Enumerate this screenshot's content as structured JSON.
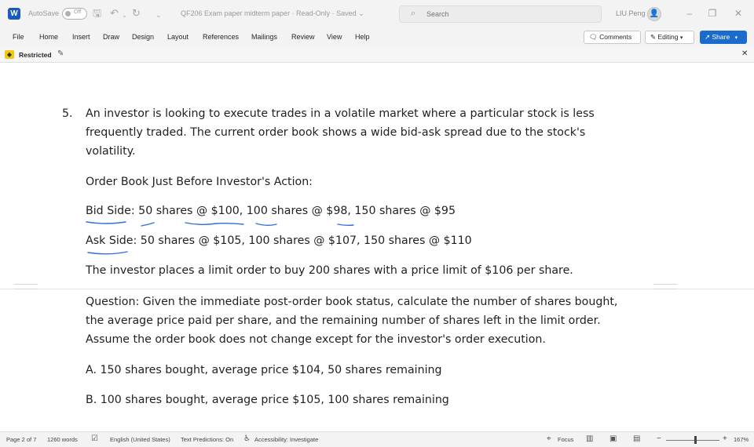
{
  "titlebar": {
    "app_letter": "W",
    "autosave_label": "AutoSave",
    "autosave_state": "Off",
    "doc_title": "QF206 Exam paper midterm paper  ·  Read-Only  ·  Saved ⌄",
    "search_placeholder": "Search",
    "user_name": "LIU Peng",
    "avatar_glyph": "👤"
  },
  "menu": {
    "items": [
      "File",
      "Home",
      "Insert",
      "Draw",
      "Design",
      "Layout",
      "References",
      "Mailings",
      "Review",
      "View",
      "Help"
    ],
    "comments": "Comments",
    "editing": "Editing",
    "share": "Share"
  },
  "restrict": {
    "label": "Restricted"
  },
  "document": {
    "question_number": "5.",
    "intro_lines": [
      "An investor is looking to execute trades in a volatile market where a particular stock is less",
      "frequently traded. The current order book shows a wide bid-ask spread due to the stock's",
      "volatility."
    ],
    "order_book_heading": "Order Book Just Before Investor's Action:",
    "bid_side": "Bid Side: 50 shares @ $100, 100 shares @ $98, 150 shares @ $95",
    "ask_side": "Ask Side: 50 shares @ $105, 100 shares @ $107, 150 shares @ $110",
    "order_line": "The investor places a limit order to buy 200 shares with a price limit of $106 per share.",
    "question_lines": [
      "Question: Given the immediate post-order book status, calculate the number of shares bought,",
      "the average price paid per share, and the remaining number of shares left in the limit order.",
      "Assume the order book does not change except for the investor's order execution."
    ],
    "option_a": "A. 150 shares bought, average price $104, 50 shares remaining",
    "option_b": "B. 100 shares bought, average price $105, 100 shares remaining"
  },
  "status": {
    "page": "Page 2 of 7",
    "words": "1260 words",
    "language": "English (United States)",
    "text_predictions": "Text Predictions: On",
    "accessibility": "Accessibility: Investigate",
    "focus": "Focus",
    "zoom": "167%"
  },
  "colors": {
    "ink": "#2f6fd6",
    "share": "#1a6bcc",
    "restricted": "#f2c811"
  }
}
